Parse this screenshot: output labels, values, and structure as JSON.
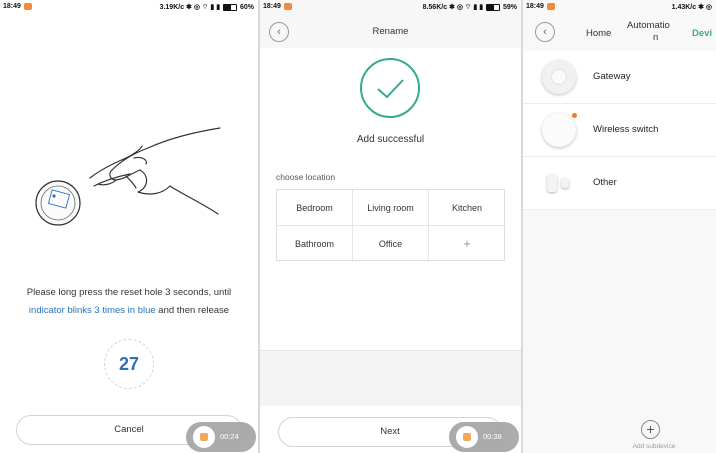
{
  "panel1": {
    "status": {
      "time": "18:49",
      "right": "3.19K/c ✱ ◎ ⌔ ▮ ▮",
      "battery": "60%",
      "battery_level": 0.6
    },
    "instruction_line1": "Please long press the reset hole  3 seconds, until",
    "instruction_line2_highlight": "indicator blinks 3 times in blue",
    "instruction_line2_rest": " and then release",
    "countdown": "27",
    "cancel_label": "Cancel",
    "recording_time": "00:24"
  },
  "panel2": {
    "status": {
      "time": "18:49",
      "right": "8.56K/c ✱ ◎ ⌔ ▮ ▮",
      "battery": "59%",
      "battery_level": 0.59
    },
    "title": "Rename",
    "success_text": "Add successful",
    "choose_label": "choose location",
    "locations": [
      "Bedroom",
      "Living room",
      "Kitchen",
      "Bathroom",
      "Office",
      "+"
    ],
    "next_label": "Next",
    "recording_time": "00:38"
  },
  "panel3": {
    "status": {
      "time": "18:49",
      "right": "1.43K/c ✱ ◎"
    },
    "tabs": {
      "home": "Home",
      "automation_line1": "Automatio",
      "automation_line2": "n",
      "device": "Devi"
    },
    "devices": [
      {
        "label": "Gateway",
        "icon": "gateway-icon"
      },
      {
        "label": "Wireless switch",
        "icon": "wireless-switch-icon"
      },
      {
        "label": "Other",
        "icon": "sensor-icon"
      }
    ],
    "add_label": "Add subdevice"
  },
  "colors": {
    "accent_green": "#34a994",
    "link_blue": "#2a73b8",
    "mi_orange": "#f08a3c"
  }
}
